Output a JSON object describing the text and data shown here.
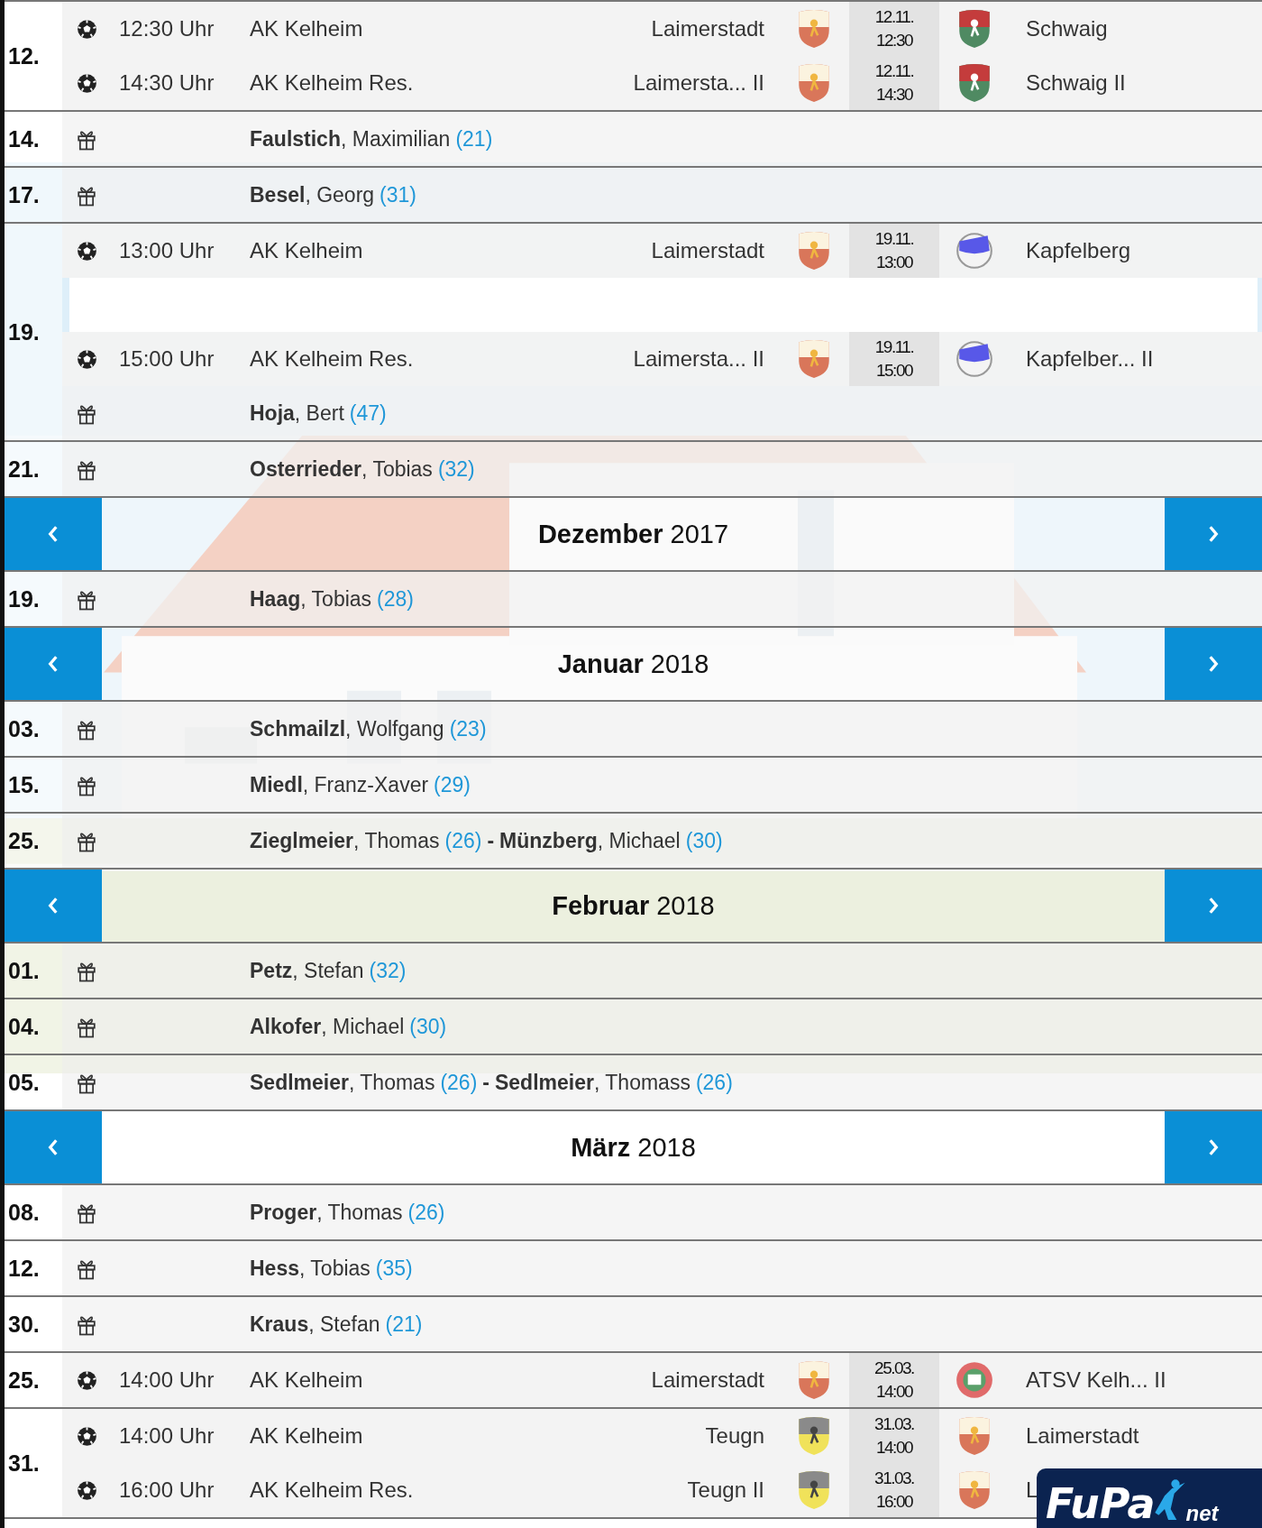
{
  "entries": [
    {
      "kind": "day",
      "day": "12.",
      "items": [
        {
          "kind": "match",
          "time": "12:30 Uhr",
          "team": "AK Kelheim",
          "home": "Laimerstadt",
          "home_crest": {
            "kind": "shield-red"
          },
          "date": "12.11.",
          "kickoff": "12:30",
          "away_crest": {
            "kind": "shield-green"
          },
          "away": "Schwaig"
        },
        {
          "kind": "match",
          "time": "14:30 Uhr",
          "team": "AK Kelheim Res.",
          "home": "Laimersta... II",
          "home_crest": {
            "kind": "shield-red"
          },
          "date": "12.11.",
          "kickoff": "14:30",
          "away_crest": {
            "kind": "shield-green"
          },
          "away": "Schwaig II"
        }
      ]
    },
    {
      "kind": "day",
      "day": "14.",
      "items": [
        {
          "kind": "birthday",
          "people": [
            {
              "name": "**Faulstich**, Maximilian",
              "age": "(21)"
            }
          ]
        }
      ]
    },
    {
      "kind": "day",
      "day": "17.",
      "items": [
        {
          "kind": "birthday",
          "people": [
            {
              "name": "**Besel**, Georg",
              "age": "(31)"
            }
          ]
        }
      ]
    },
    {
      "kind": "day",
      "day": "19.",
      "items": [
        {
          "kind": "match",
          "time": "13:00 Uhr",
          "team": "AK Kelheim",
          "home": "Laimerstadt",
          "home_crest": {
            "kind": "shield-red"
          },
          "date": "19.11.",
          "kickoff": "13:00",
          "away_crest": {
            "kind": "disc-blue"
          },
          "away": "Kapfelberg"
        },
        {
          "kind": "blank"
        },
        {
          "kind": "match",
          "time": "15:00 Uhr",
          "team": "AK Kelheim Res.",
          "home": "Laimersta... II",
          "home_crest": {
            "kind": "shield-red"
          },
          "date": "19.11.",
          "kickoff": "15:00",
          "away_crest": {
            "kind": "disc-blue"
          },
          "away": "Kapfelber... II"
        },
        {
          "kind": "birthday",
          "people": [
            {
              "name": "**Hoja**, Bert",
              "age": "(47)"
            }
          ]
        }
      ]
    },
    {
      "kind": "day",
      "day": "21.",
      "items": [
        {
          "kind": "birthday",
          "people": [
            {
              "name": "**Osterrieder**, Tobias",
              "age": "(32)"
            }
          ]
        }
      ]
    },
    {
      "kind": "month",
      "month": "Dezember",
      "year": "2017"
    },
    {
      "kind": "day",
      "day": "19.",
      "items": [
        {
          "kind": "birthday",
          "people": [
            {
              "name": "**Haag**, Tobias",
              "age": "(28)"
            }
          ]
        }
      ]
    },
    {
      "kind": "month",
      "month": "Januar",
      "year": "2018"
    },
    {
      "kind": "day",
      "day": "03.",
      "items": [
        {
          "kind": "birthday",
          "people": [
            {
              "name": "**Schmailzl**, Wolfgang",
              "age": "(23)"
            }
          ]
        }
      ]
    },
    {
      "kind": "day",
      "day": "15.",
      "items": [
        {
          "kind": "birthday",
          "people": [
            {
              "name": "**Miedl**, Franz-Xaver",
              "age": "(29)"
            }
          ]
        }
      ]
    },
    {
      "kind": "day",
      "day": "25.",
      "items": [
        {
          "kind": "birthday",
          "separator": "-",
          "people": [
            {
              "name": "**Zieglmeier**, Thomas",
              "age": "(26)"
            },
            {
              "name": "**Münzberg**, Michael",
              "age": "(30)"
            }
          ]
        }
      ]
    },
    {
      "kind": "month",
      "month": "Februar",
      "year": "2018"
    },
    {
      "kind": "day",
      "day": "01.",
      "items": [
        {
          "kind": "birthday",
          "people": [
            {
              "name": "**Petz**, Stefan",
              "age": "(32)"
            }
          ]
        }
      ]
    },
    {
      "kind": "day",
      "day": "04.",
      "items": [
        {
          "kind": "birthday",
          "people": [
            {
              "name": "**Alkofer**, Michael",
              "age": "(30)"
            }
          ]
        }
      ]
    },
    {
      "kind": "day",
      "day": "05.",
      "items": [
        {
          "kind": "birthday",
          "separator": "-",
          "people": [
            {
              "name": "**Sedlmeier**, Thomas",
              "age": "(26)"
            },
            {
              "name": "**Sedlmeier**, Thomass",
              "age": "(26)"
            }
          ]
        }
      ]
    },
    {
      "kind": "month",
      "month": "März",
      "year": "2018"
    },
    {
      "kind": "day",
      "day": "08.",
      "items": [
        {
          "kind": "birthday",
          "people": [
            {
              "name": "**Proger**, Thomas",
              "age": "(26)"
            }
          ]
        }
      ]
    },
    {
      "kind": "day",
      "day": "12.",
      "items": [
        {
          "kind": "birthday",
          "people": [
            {
              "name": "**Hess**, Tobias",
              "age": "(35)"
            }
          ]
        }
      ]
    },
    {
      "kind": "day",
      "day": "30.",
      "items": [
        {
          "kind": "birthday",
          "people": [
            {
              "name": "**Kraus**, Stefan",
              "age": "(21)"
            }
          ]
        }
      ]
    },
    {
      "kind": "day",
      "day": "25.",
      "items": [
        {
          "kind": "match",
          "time": "14:00 Uhr",
          "team": "AK Kelheim",
          "home": "Laimerstadt",
          "home_crest": {
            "kind": "shield-red"
          },
          "date": "25.03.",
          "kickoff": "14:00",
          "away_crest": {
            "kind": "disc-red"
          },
          "away": "ATSV Kelh... II"
        }
      ]
    },
    {
      "kind": "day",
      "day": "31.",
      "items": [
        {
          "kind": "match",
          "time": "14:00 Uhr",
          "team": "AK Kelheim",
          "home": "Teugn",
          "home_crest": {
            "kind": "shield-yellow"
          },
          "date": "31.03.",
          "kickoff": "14:00",
          "away_crest": {
            "kind": "shield-red"
          },
          "away": "Laimerstadt"
        },
        {
          "kind": "match",
          "time": "16:00 Uhr",
          "team": "AK Kelheim Res.",
          "home": "Teugn II",
          "home_crest": {
            "kind": "shield-yellow"
          },
          "date": "31.03.",
          "kickoff": "16:00",
          "away_crest": {
            "kind": "shield-red"
          },
          "away": "L"
        }
      ]
    }
  ],
  "logo": {
    "name": "FuPa",
    "suffix": "net"
  }
}
